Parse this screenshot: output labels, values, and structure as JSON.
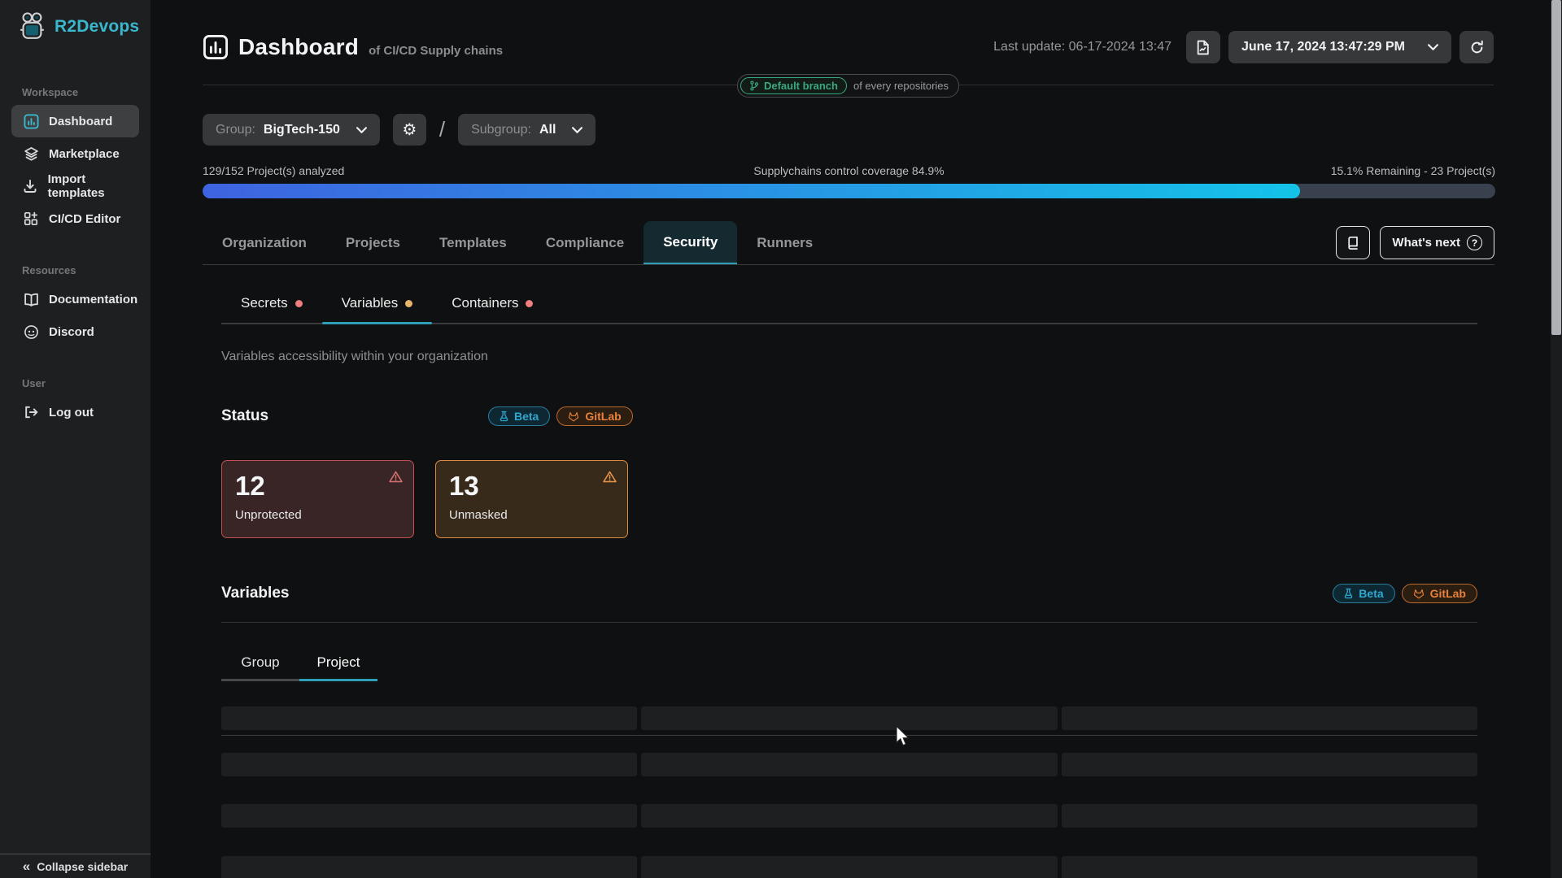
{
  "colors": {
    "accent-teal": "#3ab7cd",
    "progress-start": "#3e63e0",
    "progress-end": "#14c3e8",
    "tab-underline": "#2f9cb8",
    "beta-color": "#2fa7cf",
    "gitlab-color": "#e8813c",
    "danger-border": "#c05150",
    "warning-border": "#dc8b42",
    "branch-green": "#3aa981"
  },
  "sidebar": {
    "logo_text": "R2Devops",
    "sections": [
      {
        "label": "Workspace",
        "items": [
          {
            "label": "Dashboard",
            "icon": "bar-chart-icon",
            "active": true
          },
          {
            "label": "Marketplace",
            "icon": "layers-icon",
            "active": false
          },
          {
            "label": "Import templates",
            "icon": "download-icon",
            "active": false
          },
          {
            "label": "CI/CD Editor",
            "icon": "grid-plus-icon",
            "active": false
          }
        ]
      },
      {
        "label": "Resources",
        "items": [
          {
            "label": "Documentation",
            "icon": "open-book-icon",
            "active": false
          },
          {
            "label": "Discord",
            "icon": "discord-icon",
            "active": false
          }
        ]
      },
      {
        "label": "User",
        "items": [
          {
            "label": "Log out",
            "icon": "logout-icon",
            "active": false
          }
        ]
      }
    ],
    "collapse_label": "Collapse sidebar",
    "collapse_glyph": "«"
  },
  "header": {
    "title": "Dashboard",
    "subtitle": "of CI/CD Supply chains",
    "last_update": "Last update: 06-17-2024 13:47",
    "datetime_value": "June 17, 2024 13:47:29 PM",
    "branch_badge": "Default branch",
    "branch_scope": "of every repositories"
  },
  "filters": {
    "group_label": "Group:",
    "group_value": "BigTech-150",
    "separator": "/",
    "subgroup_label": "Subgroup:",
    "subgroup_value": "All"
  },
  "progress": {
    "left_label": "129/152 Project(s) analyzed",
    "center_label": "Supplychains control coverage 84.9%",
    "right_label": "15.1% Remaining - 23 Project(s)",
    "percent": 84.9
  },
  "tabs": {
    "items": [
      {
        "label": "Organization",
        "active": false
      },
      {
        "label": "Projects",
        "active": false
      },
      {
        "label": "Templates",
        "active": false
      },
      {
        "label": "Compliance",
        "active": false
      },
      {
        "label": "Security",
        "active": true
      },
      {
        "label": "Runners",
        "active": false
      }
    ],
    "whats_next_label": "What's next",
    "whats_next_glyph": "?"
  },
  "badges": {
    "beta": "Beta",
    "gitlab": "GitLab"
  },
  "security": {
    "subtabs": [
      {
        "label": "Secrets",
        "dot": "#ef7e7e",
        "active": false
      },
      {
        "label": "Variables",
        "dot": "#e7b568",
        "active": true
      },
      {
        "label": "Containers",
        "dot": "#ef7e7e",
        "active": false
      }
    ],
    "description": "Variables accessibility within your organization",
    "status": {
      "heading": "Status",
      "cards": [
        {
          "value": "12",
          "label": "Unprotected",
          "severity": "danger"
        },
        {
          "value": "13",
          "label": "Unmasked",
          "severity": "warning"
        }
      ]
    },
    "variables": {
      "heading": "Variables",
      "tabs": [
        {
          "label": "Group",
          "active": false
        },
        {
          "label": "Project",
          "active": true
        }
      ],
      "skeleton_rows": 4
    }
  }
}
